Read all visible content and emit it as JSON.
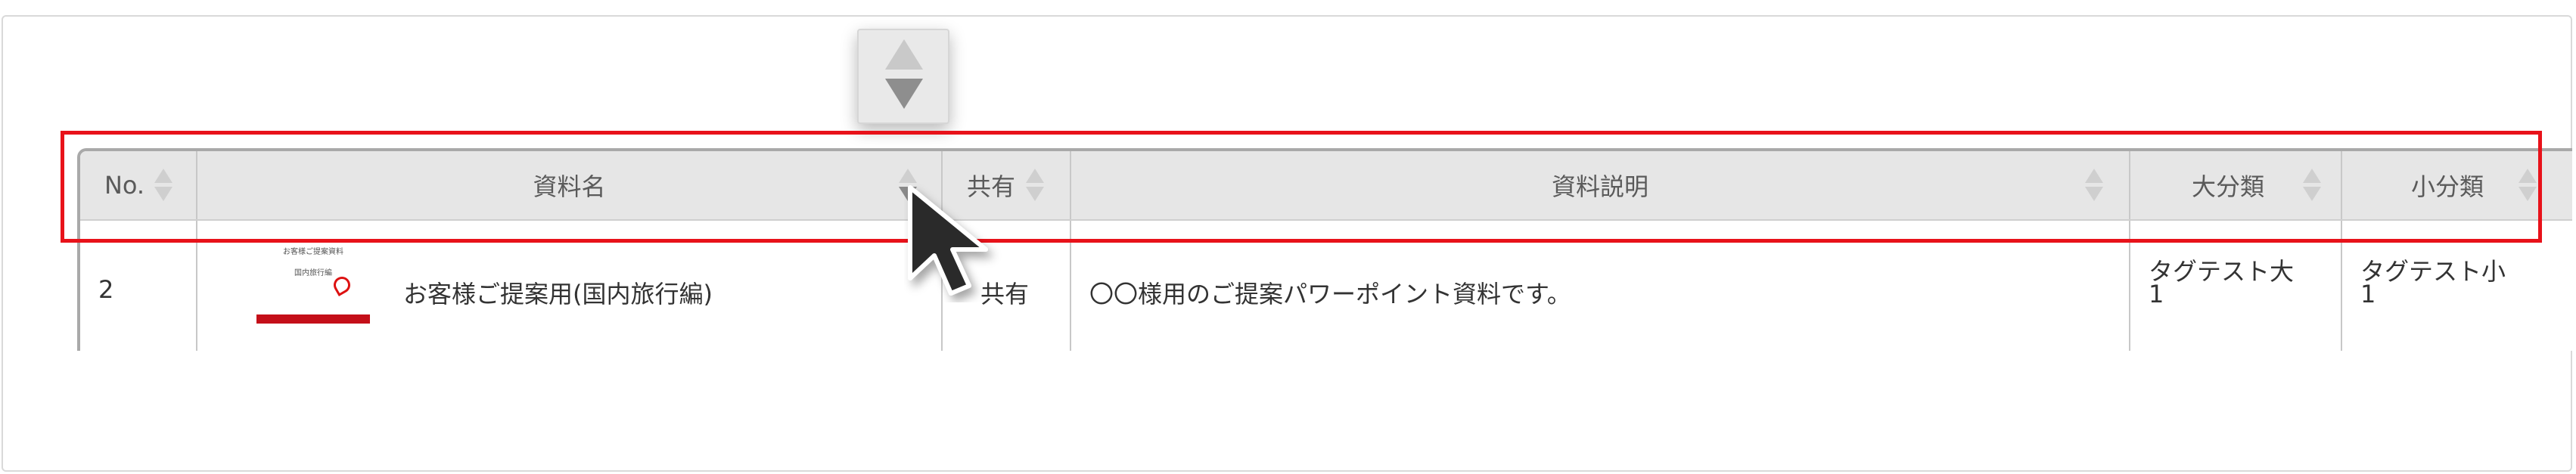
{
  "sort_popup": {
    "up_icon": "sort-up-icon",
    "down_icon": "sort-down-icon"
  },
  "table": {
    "headers": [
      {
        "label": "No.",
        "icon": "sort-icon"
      },
      {
        "label": "資料名",
        "icon": "sort-icon",
        "active": true
      },
      {
        "label": "共有",
        "icon": "sort-icon"
      },
      {
        "label": "資料説明",
        "icon": "sort-icon"
      },
      {
        "label": "大分類",
        "icon": "sort-icon"
      },
      {
        "label": "小分類",
        "icon": "sort-icon"
      }
    ],
    "rows": [
      {
        "no": "2",
        "name": "お客様ご提案用(国内旅行編)",
        "thumbnail": {
          "line1": "お客様ご提案資料",
          "line2": "国内旅行編"
        },
        "shared": "共有",
        "description": "〇〇様用のご提案パワーポイント資料です。",
        "major": "タグテスト大\n1",
        "minor": "タグテスト小\n1"
      }
    ]
  },
  "colors": {
    "highlight": "#e8121a",
    "header_bg": "#e6e6e6",
    "thumb_bar": "#c40f19"
  },
  "cursor_icon": "arrow-cursor-icon"
}
